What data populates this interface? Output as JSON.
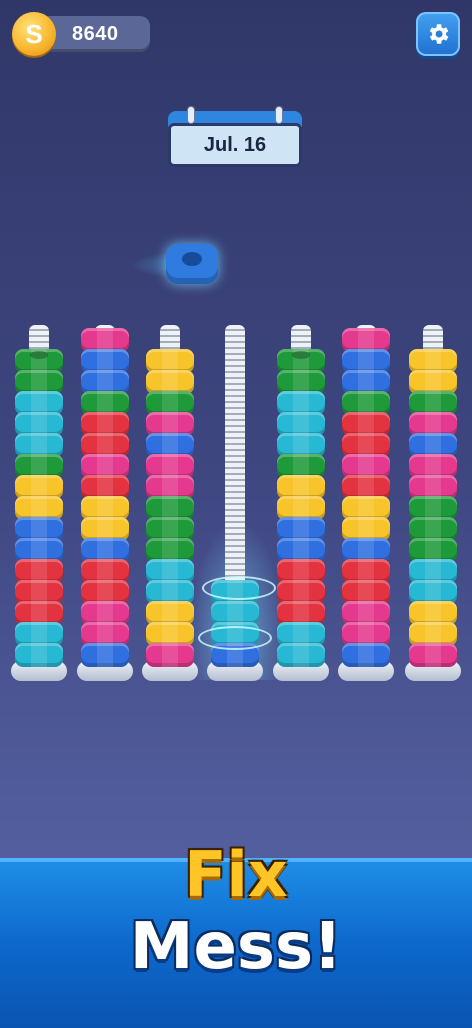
{
  "hud": {
    "coin_symbol": "S",
    "coin_count": "8640",
    "settings_icon": "gear-icon"
  },
  "date_plaque": {
    "label": "Jul. 16"
  },
  "colors": {
    "green": "#1f9a3a",
    "cyan": "#27b8d3",
    "yellow": "#f7c42a",
    "blue": "#2f6fe0",
    "red": "#e33240",
    "pink": "#e4398e"
  },
  "poles": [
    {
      "capped": true,
      "nuts": [
        "green",
        "green",
        "cyan",
        "cyan",
        "cyan",
        "green",
        "yellow",
        "yellow",
        "blue",
        "blue",
        "red",
        "red",
        "red",
        "cyan",
        "cyan"
      ]
    },
    {
      "capped": false,
      "nuts": [
        "pink",
        "blue",
        "blue",
        "green",
        "red",
        "red",
        "pink",
        "red",
        "yellow",
        "yellow",
        "blue",
        "red",
        "red",
        "pink",
        "pink",
        "blue"
      ]
    },
    {
      "capped": false,
      "nuts": [
        "yellow",
        "yellow",
        "green",
        "pink",
        "blue",
        "pink",
        "pink",
        "green",
        "green",
        "green",
        "cyan",
        "cyan",
        "yellow",
        "yellow",
        "pink"
      ]
    },
    {
      "capped": false,
      "nuts": [
        "cyan",
        "cyan",
        "cyan",
        "blue"
      ]
    },
    {
      "capped": true,
      "nuts": [
        "green",
        "green",
        "cyan",
        "cyan",
        "cyan",
        "green",
        "yellow",
        "yellow",
        "blue",
        "blue",
        "red",
        "red",
        "red",
        "cyan",
        "cyan"
      ]
    },
    {
      "capped": false,
      "nuts": [
        "pink",
        "blue",
        "blue",
        "green",
        "red",
        "red",
        "pink",
        "red",
        "yellow",
        "yellow",
        "blue",
        "red",
        "red",
        "pink",
        "pink",
        "blue"
      ]
    },
    {
      "capped": false,
      "nuts": [
        "yellow",
        "yellow",
        "green",
        "pink",
        "blue",
        "pink",
        "pink",
        "green",
        "green",
        "green",
        "cyan",
        "cyan",
        "yellow",
        "yellow",
        "pink"
      ]
    }
  ],
  "banner": {
    "line1": "Fix",
    "line2": "Mess!"
  }
}
